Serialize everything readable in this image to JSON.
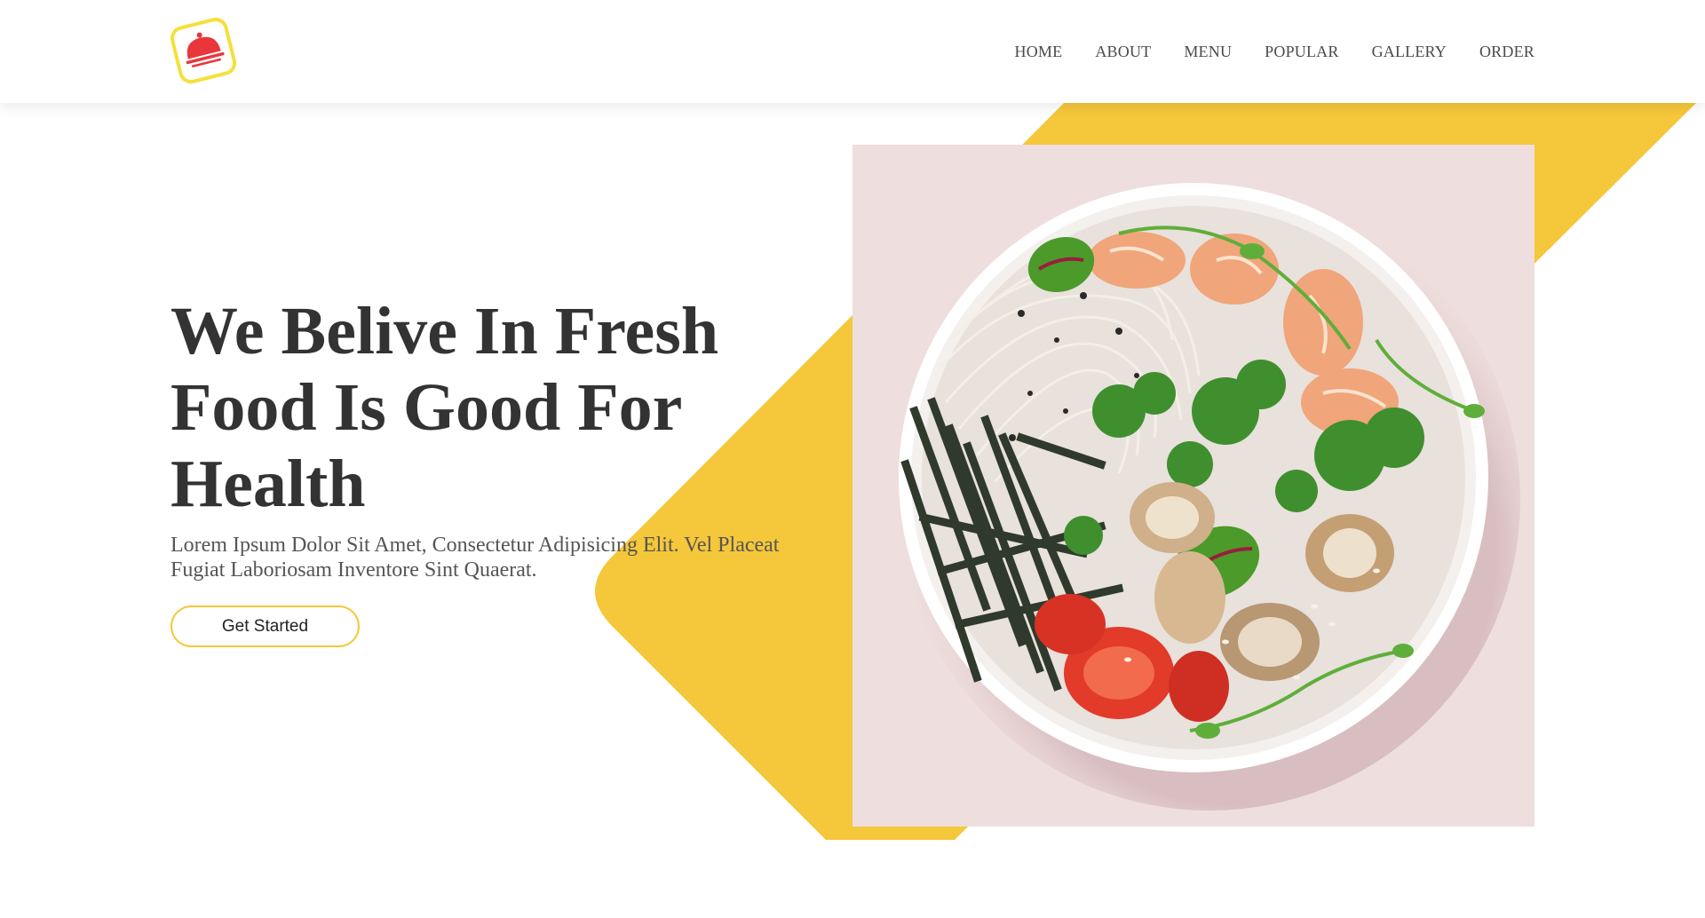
{
  "header": {
    "logo_icon": "restaurant-cloche-icon",
    "nav": [
      {
        "label": "HOME"
      },
      {
        "label": "ABOUT"
      },
      {
        "label": "MENU"
      },
      {
        "label": "POPULAR"
      },
      {
        "label": "GALLERY"
      },
      {
        "label": "ORDER"
      }
    ]
  },
  "hero": {
    "title": "We Belive In Fresh Food Is Good For Health",
    "description": "Lorem Ipsum Dolor Sit Amet, Consectetur Adipisicing Elit. Vel Placeat Fugiat Laboriosam Inventore Sint Quaerat.",
    "cta_label": "Get Started"
  },
  "colors": {
    "accent": "#f5c73a",
    "logo_red": "#e8363b",
    "text_dark": "#333333",
    "photo_bg": "#efdede"
  }
}
